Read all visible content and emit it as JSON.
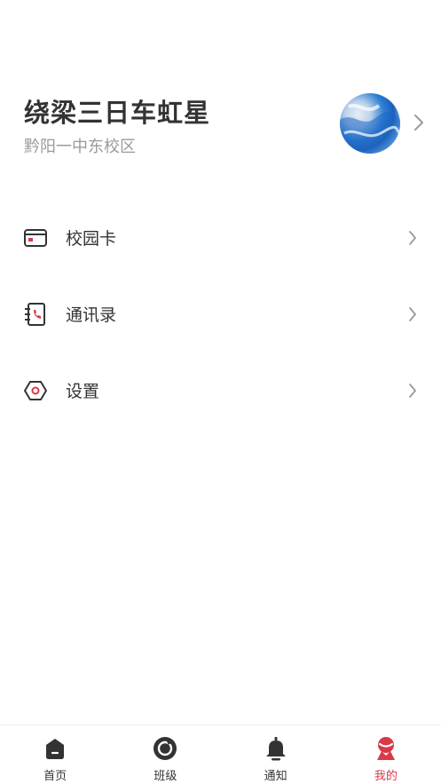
{
  "profile": {
    "name": "绕梁三日车虹星",
    "school": "黔阳一中东校区"
  },
  "menu": {
    "items": [
      {
        "label": "校园卡",
        "icon": "card-icon"
      },
      {
        "label": "通讯录",
        "icon": "contacts-book-icon"
      },
      {
        "label": "设置",
        "icon": "settings-hexagon-icon"
      }
    ]
  },
  "tabbar": {
    "tabs": [
      {
        "label": "首页",
        "icon": "home-icon",
        "active": false
      },
      {
        "label": "班级",
        "icon": "class-ring-icon",
        "active": false
      },
      {
        "label": "通知",
        "icon": "bell-icon",
        "active": false
      },
      {
        "label": "我的",
        "icon": "profile-icon",
        "active": true
      }
    ]
  },
  "colors": {
    "accent": "#d83a4a",
    "text": "#333333",
    "muted": "#9a9a9a",
    "icon_dark": "#333333"
  }
}
